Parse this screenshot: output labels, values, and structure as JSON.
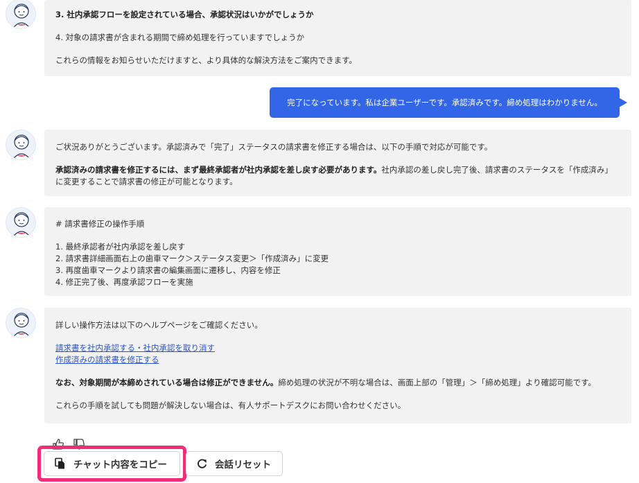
{
  "messages": {
    "bot1": {
      "line1": "3. 社内承認フローを設定されている場合、承認状況はいかがでしょうか",
      "line2": "4. 対象の請求書が含まれる期間で締め処理を行っていますでしょうか",
      "line3": "これらの情報をお知らせいただけますと、より具体的な解決方法をご案内できます。"
    },
    "user1": {
      "text": "完了になっています。私は企業ユーザーです。承認済みです。締め処理はわかりません。"
    },
    "bot2": {
      "line1": "ご状況ありがとうございます。承認済みで「完了」ステータスの請求書を修正する場合は、以下の手順で対応が可能です。",
      "line2_bold": "承認済みの請求書を修正するには、まず最終承認者が社内承認を差し戻す必要があります。",
      "line2_rest": "社内承認の差し戻し完了後、請求書のステータスを「作成済み」に変更することで請求書の修正が可能となります。"
    },
    "bot3": {
      "heading": "# 請求書修正の操作手順",
      "steps": [
        "1. 最終承認者が社内承認を差し戻す",
        "2. 請求書詳細画面右上の歯車マーク＞ステータス変更＞「作成済み」に変更",
        "3. 再度歯車マークより請求書の編集画面に遷移し、内容を修正",
        "4. 修正完了後、再度承認フローを実施"
      ]
    },
    "bot4": {
      "intro": "詳しい操作方法は以下のヘルプページをご確認ください。",
      "link1": "請求書を社内承認する・社内承認を取り消す",
      "link2": "作成済みの請求書を修正する",
      "note_bold": "なお、対象期間が本締めされている場合は修正ができません。",
      "note_rest": "締め処理の状況が不明な場合は、画面上部の「管理」＞「締め処理」より確認可能です。",
      "closing": "これらの手順を試しても問題が解決しない場合は、有人サポートデスクにお問い合わせください。"
    }
  },
  "actions": {
    "copy_label": "チャット内容をコピー",
    "reset_label": "会話リセット"
  },
  "icons": {
    "avatar": "bot-avatar-icon",
    "like": "thumbs-up-icon",
    "dislike": "thumbs-down-icon",
    "copy": "copy-icon",
    "reset": "refresh-icon"
  },
  "colors": {
    "user_bubble": "#3366e6",
    "bot_bubble": "#f2f2f2",
    "link": "#2f56c6",
    "highlight": "#ee2e78"
  }
}
